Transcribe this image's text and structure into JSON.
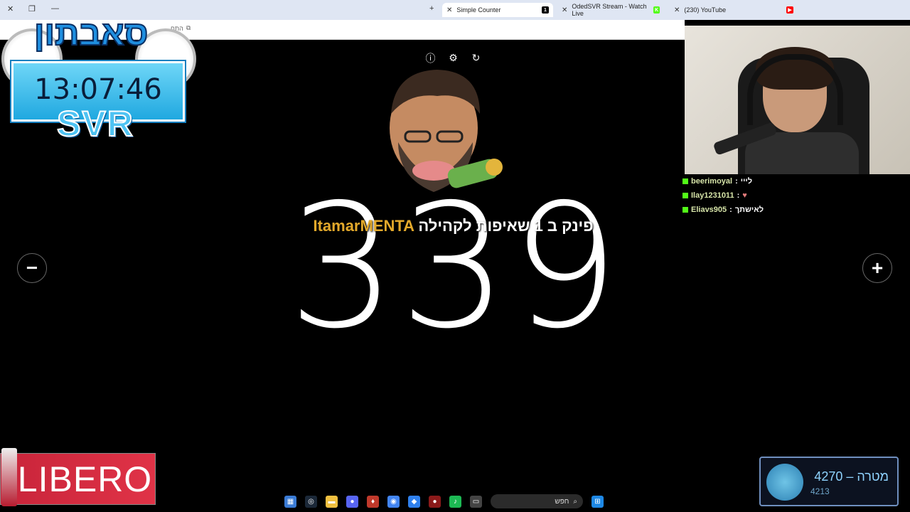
{
  "browser": {
    "tabs": [
      {
        "title": "Simple Counter",
        "active": true
      },
      {
        "title": "OdedSVR Stream - Watch Live",
        "active": false
      },
      {
        "title": "(230) YouTube",
        "active": false
      }
    ],
    "address_hint": "התח"
  },
  "stage": {
    "counter_value": "339",
    "minus_label": "−",
    "plus_label": "+",
    "alert": {
      "name": "ItamarMENTA",
      "message": "פינק ב 1 שאיפות לקהילה"
    }
  },
  "clock_overlay": {
    "time": "13:07:46",
    "brand": "SVR",
    "title": "סאבתון"
  },
  "chat": {
    "messages": [
      {
        "user": "beerimoyal",
        "text": "לייי"
      },
      {
        "user": "Ilay1231011",
        "text": ""
      },
      {
        "user": "Eliavs905",
        "text": "לאישתך"
      }
    ]
  },
  "taskbar": {
    "search_placeholder": "חפש"
  },
  "ad": {
    "brand": "LIBERO"
  },
  "goal": {
    "label": "מטרה –",
    "target": "4270",
    "current": "4213"
  },
  "colors": {
    "counter": "#ffffff",
    "alert_name": "#e3a92b",
    "kick_green": "#53fc18",
    "clock_box": "#20a8e0"
  }
}
